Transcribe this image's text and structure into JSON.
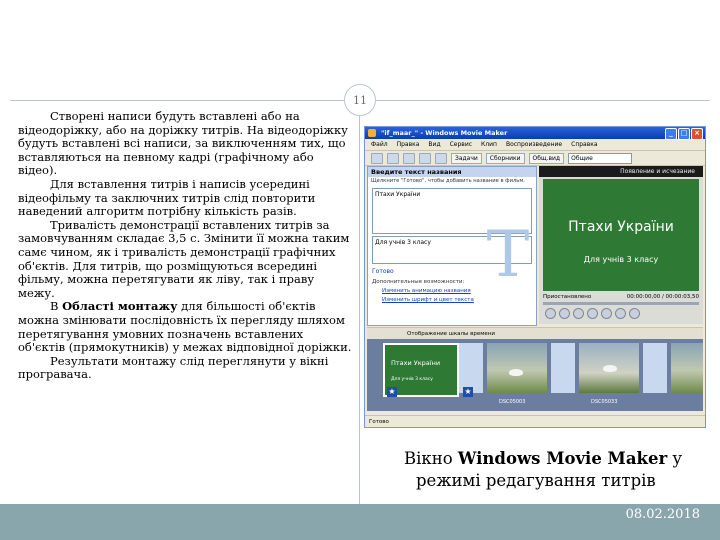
{
  "page_number": "11",
  "date": "08.02.2018",
  "left_paragraphs": [
    "Створені написи будуть вставлені або на відеодоріжку, або на доріжку титрів. На відеодоріжку будуть вставлені всі написи, за виключенням тих, що вставляються на певному кадрі (графічному або відео).",
    "Для вставлення титрів і написів усередині відеофільму та заключних титрів слід повторити наведений алгоритм потрібну кількість разів.",
    "Тривалість демонстрації вставлених титрів за замовчуванням складає 3,5 с. Змінити її можна таким самє чином, як і тривалість демонстрації графічних об'єктів. Для титрів, що розміщуються всередині фільму, можна перетягувати як ліву, так і праву межу."
  ],
  "p4": {
    "before": "В ",
    "bold": "Області монтажу",
    "after": " для більшості об'єктів можна змінювати послідовність їх перегляду шляхом перетягування умовних позначень вставлених об'єктів (прямокутників) у межах відповідної доріжки."
  },
  "p5": "Результати монтажу слід переглянути у вікні програвача.",
  "caption": {
    "pre": "Вікно ",
    "bold": "Windows Movie Maker",
    "post": " у",
    "line2": "режимі редагування титрів"
  },
  "wmm": {
    "title": "\"if_maar_\" - Windows Movie Maker",
    "menu": [
      "Файл",
      "Правка",
      "Вид",
      "Сервис",
      "Клип",
      "Воспроизведение",
      "Справка"
    ],
    "toolbar": [
      "Задачи",
      "Сборники",
      "Общ.вид"
    ],
    "toolbar_combo": "Общие",
    "task_header": "Введите текст названия",
    "task_sub": "Щелкните \"Готово\", чтобы добавить название в фильм.",
    "edit1": "Птахи України",
    "edit2": "Для учнів 3 класу",
    "ready": "Готово",
    "more": "Дополнительные возможности:",
    "link1": "Изменить анимацию названия",
    "link2": "Изменить шрифт и цвет текста",
    "preview_title": "Появление и исчезание",
    "preview_main": "Птахи України",
    "preview_sub": "Для учнів 3 класу",
    "preview_state": "Приостановлено",
    "preview_time": "00:00:00,00 / 00:00:03,50",
    "storyboard_label": "Отображение шкалы времени",
    "clip1_title": "Птахи України",
    "clip1_sub": "Для учнів 3 класу",
    "clip_names": [
      "DSC05003",
      "DSC05033"
    ],
    "status": "Готово"
  }
}
